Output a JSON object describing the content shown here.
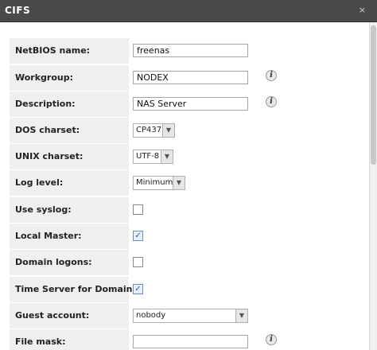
{
  "window": {
    "title": "CIFS",
    "close_label": "×"
  },
  "fields": {
    "netbios": {
      "label": "NetBIOS name:",
      "value": "freenas"
    },
    "workgroup": {
      "label": "Workgroup:",
      "value": "NODEX"
    },
    "description": {
      "label": "Description:",
      "value": "NAS Server"
    },
    "dos_charset": {
      "label": "DOS charset:",
      "value": "CP437"
    },
    "unix_charset": {
      "label": "UNIX charset:",
      "value": "UTF-8"
    },
    "log_level": {
      "label": "Log level:",
      "value": "Minimum"
    },
    "use_syslog": {
      "label": "Use syslog:",
      "checked": false
    },
    "local_master": {
      "label": "Local Master:",
      "checked": true
    },
    "domain_logons": {
      "label": "Domain logons:",
      "checked": false
    },
    "time_server": {
      "label": "Time Server for Domain:",
      "checked": true
    },
    "guest_account": {
      "label": "Guest account:",
      "value": "nobody"
    },
    "file_mask": {
      "label": "File mask:",
      "value": ""
    }
  },
  "icons": {
    "info": "info-icon",
    "dropdown": "chevron-down-icon",
    "check": "checkmark-icon"
  }
}
